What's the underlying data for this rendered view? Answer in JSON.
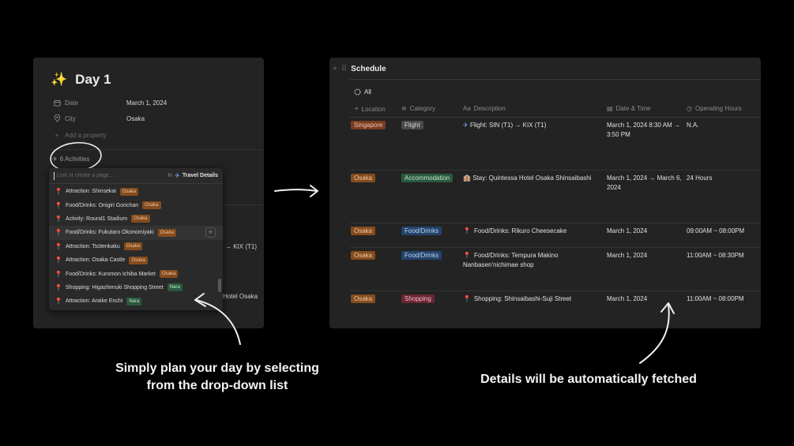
{
  "left": {
    "title_icon": "sparkles-icon",
    "title": "Day 1",
    "properties": [
      {
        "label": "Date",
        "value": "March 1, 2024",
        "icon": "calendar-icon"
      },
      {
        "label": "City",
        "value": "Osaka",
        "icon": "location-icon"
      }
    ],
    "add_property": "Add a property",
    "activities": "6 Activities",
    "background_text": [
      "→ KIX (T1)",
      "Hotel Osaka"
    ],
    "dropdown": {
      "search_placeholder": "Link or create a page...",
      "in_label": "In",
      "target": "Travel Details",
      "items": [
        {
          "name": "Attraction: Shinsekai",
          "tag": "Osaka"
        },
        {
          "name": "Food/Drinks: Onigiri Gorichan",
          "tag": "Osaka"
        },
        {
          "name": "Activity: Round1 Stadium",
          "tag": "Osaka"
        },
        {
          "name": "Food/Drinks: Fukutaro Okonomiyaki",
          "tag": "Osaka"
        },
        {
          "name": "Attraction: Tsūtenkaku",
          "tag": "Osaka"
        },
        {
          "name": "Attraction: Osaka Castle",
          "tag": "Osaka"
        },
        {
          "name": "Food/Drinks: Kuromon Ichiba Market",
          "tag": "Osaka"
        },
        {
          "name": "Shopping: Higashimuki Shopping Street",
          "tag": "Nara"
        },
        {
          "name": "Attraction: Araike Enchi",
          "tag": "Nara"
        }
      ]
    }
  },
  "right": {
    "title": "Schedule",
    "view_tab": "All",
    "columns": [
      "Location",
      "Category",
      "Description",
      "Date & Time",
      "Operating Hours"
    ],
    "rows": [
      {
        "location": "Singapore",
        "category": "Flight",
        "icon": "airplane-icon",
        "description": "Flight: SIN (T1) → KIX (T1)",
        "datetime": "March 1, 2024 8:30 AM → 3:50 PM",
        "hours": "N.A."
      },
      {
        "location": "Osaka",
        "category": "Accommodation",
        "icon": "hotel-icon",
        "description": "Stay: Quintessa Hotel Osaka Shinsaibashi",
        "datetime": "March 1, 2024 → March 6, 2024",
        "hours": "24 Hours"
      },
      {
        "location": "Osaka",
        "category": "Food/Drinks",
        "icon": "pin-icon",
        "description": "Food/Drinks: Rikuro Cheesecake",
        "datetime": "March 1, 2024",
        "hours": "09:00AM ~ 08:00PM"
      },
      {
        "location": "Osaka",
        "category": "Food/Drinks",
        "icon": "pin-icon",
        "description": "Food/Drinks: Tempura Makino Nanbasen'nichimae shop",
        "datetime": "March 1, 2024",
        "hours": "11:00AM ~ 08:30PM"
      },
      {
        "location": "Osaka",
        "category": "Shopping",
        "icon": "pin-icon",
        "description": "Shopping: Shinsaibashi-Suji Street",
        "datetime": "March 1, 2024",
        "hours": "11:00AM ~ 08:00PM"
      }
    ]
  },
  "captions": {
    "left": "Simply plan your day by selecting from the drop-down list",
    "right": "Details will be automatically fetched"
  }
}
